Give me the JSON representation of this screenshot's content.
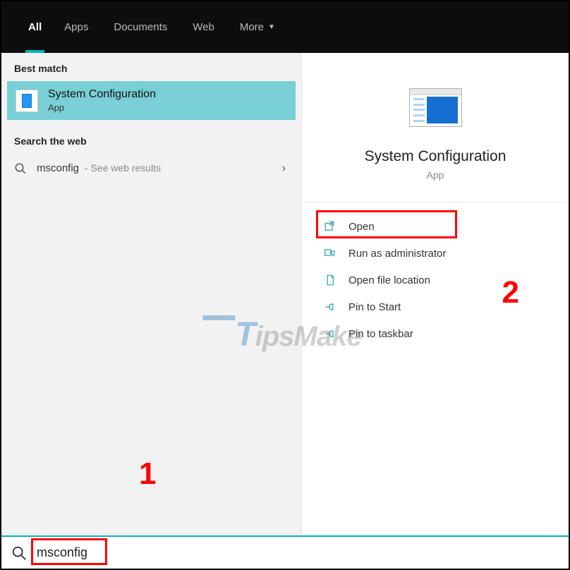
{
  "header": {
    "tabs": [
      {
        "label": "All",
        "active": true
      },
      {
        "label": "Apps",
        "active": false
      },
      {
        "label": "Documents",
        "active": false
      },
      {
        "label": "Web",
        "active": false
      },
      {
        "label": "More",
        "active": false,
        "dropdown": true
      }
    ]
  },
  "left": {
    "best_match_label": "Best match",
    "best_item": {
      "title": "System Configuration",
      "subtitle": "App"
    },
    "search_web_label": "Search the web",
    "web_item": {
      "term": "msconfig",
      "suffix": " - See web results"
    }
  },
  "right": {
    "title": "System Configuration",
    "subtitle": "App",
    "actions": {
      "open": "Open",
      "run_admin": "Run as administrator",
      "open_loc": "Open file location",
      "pin_start": "Pin to Start",
      "pin_taskbar": "Pin to taskbar"
    }
  },
  "search": {
    "value": "msconfig"
  },
  "annotations": {
    "num1": "1",
    "num2": "2"
  },
  "watermark": {
    "prefix": "T",
    "rest": "ipsMake"
  }
}
